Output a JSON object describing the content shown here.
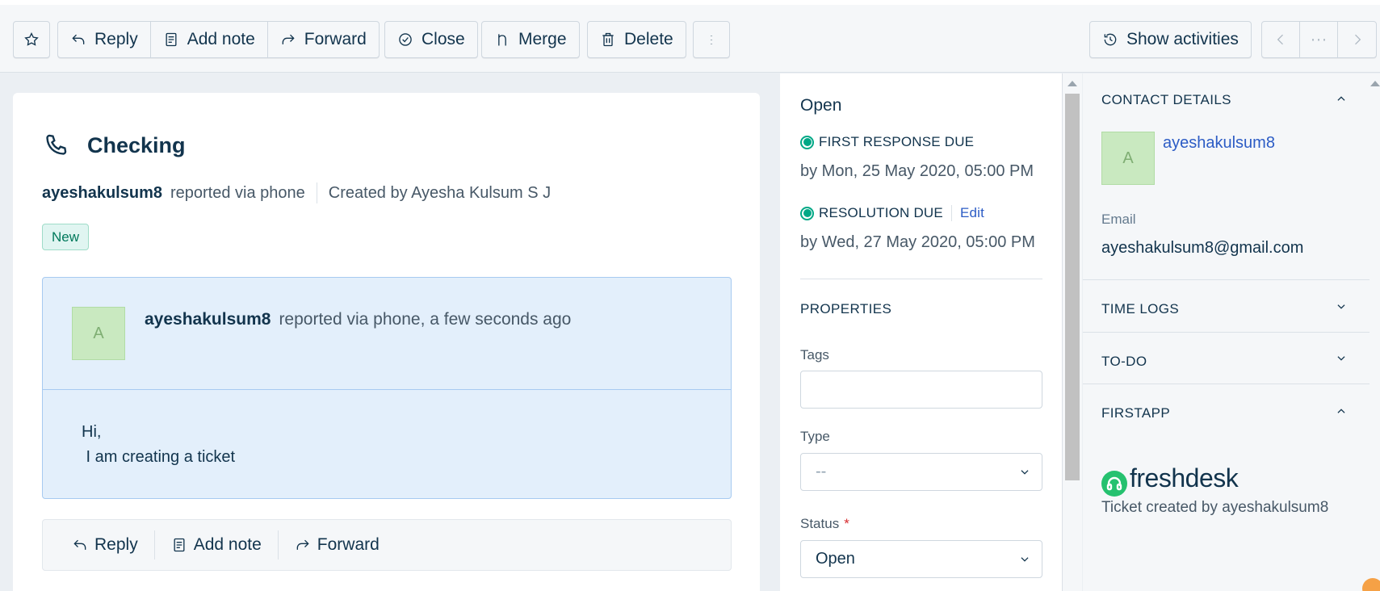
{
  "toolbar": {
    "star_icon": "star-icon",
    "actions": {
      "reply": "Reply",
      "add_note": "Add note",
      "forward": "Forward",
      "close": "Close",
      "merge": "Merge",
      "delete": "Delete"
    },
    "more_icon": "vertical-dots-icon",
    "show_activities": "Show activities",
    "pager_more": "···"
  },
  "ticket": {
    "source_icon": "phone-icon",
    "subject": "Checking",
    "requester": "ayeshakulsum8",
    "reported_via": "reported via phone",
    "created_by": "Created by Ayesha Kulsum S J",
    "status_badge": "New",
    "conversation": {
      "avatar_initial": "A",
      "author": "ayeshakulsum8",
      "meta": "reported via phone, a few seconds ago",
      "body_line1": "Hi,",
      "body_line2": " I am creating a ticket"
    },
    "reply_bar": {
      "reply": "Reply",
      "add_note": "Add note",
      "forward": "Forward"
    }
  },
  "properties": {
    "status_heading": "Open",
    "first_response": {
      "label": "FIRST RESPONSE DUE",
      "due": "by Mon, 25 May 2020, 05:00 PM"
    },
    "resolution": {
      "label": "RESOLUTION DUE",
      "edit": "Edit",
      "due": "by Wed, 27 May 2020, 05:00 PM"
    },
    "section_title": "PROPERTIES",
    "tags_label": "Tags",
    "tags_value": "",
    "type_label": "Type",
    "type_value": "--",
    "status_label": "Status",
    "status_required": "*",
    "status_value": "Open"
  },
  "sidebar": {
    "contact_details": "CONTACT DETAILS",
    "avatar_initial": "A",
    "contact_name": "ayeshakulsum8",
    "email_label": "Email",
    "email_value": "ayeshakulsum8@gmail.com",
    "time_logs": "TIME LOGS",
    "todo": "TO-DO",
    "firstapp": "FIRSTAPP",
    "app_logo_word": "freshdesk",
    "app_caption": "Ticket created by ayeshakulsum8"
  },
  "colors": {
    "brand_blue": "#2c5cc5",
    "sla_green": "#00a886",
    "badge_green": "#00795b",
    "conversation_bg": "#e3effb",
    "freshdesk_green": "#25c16f"
  }
}
